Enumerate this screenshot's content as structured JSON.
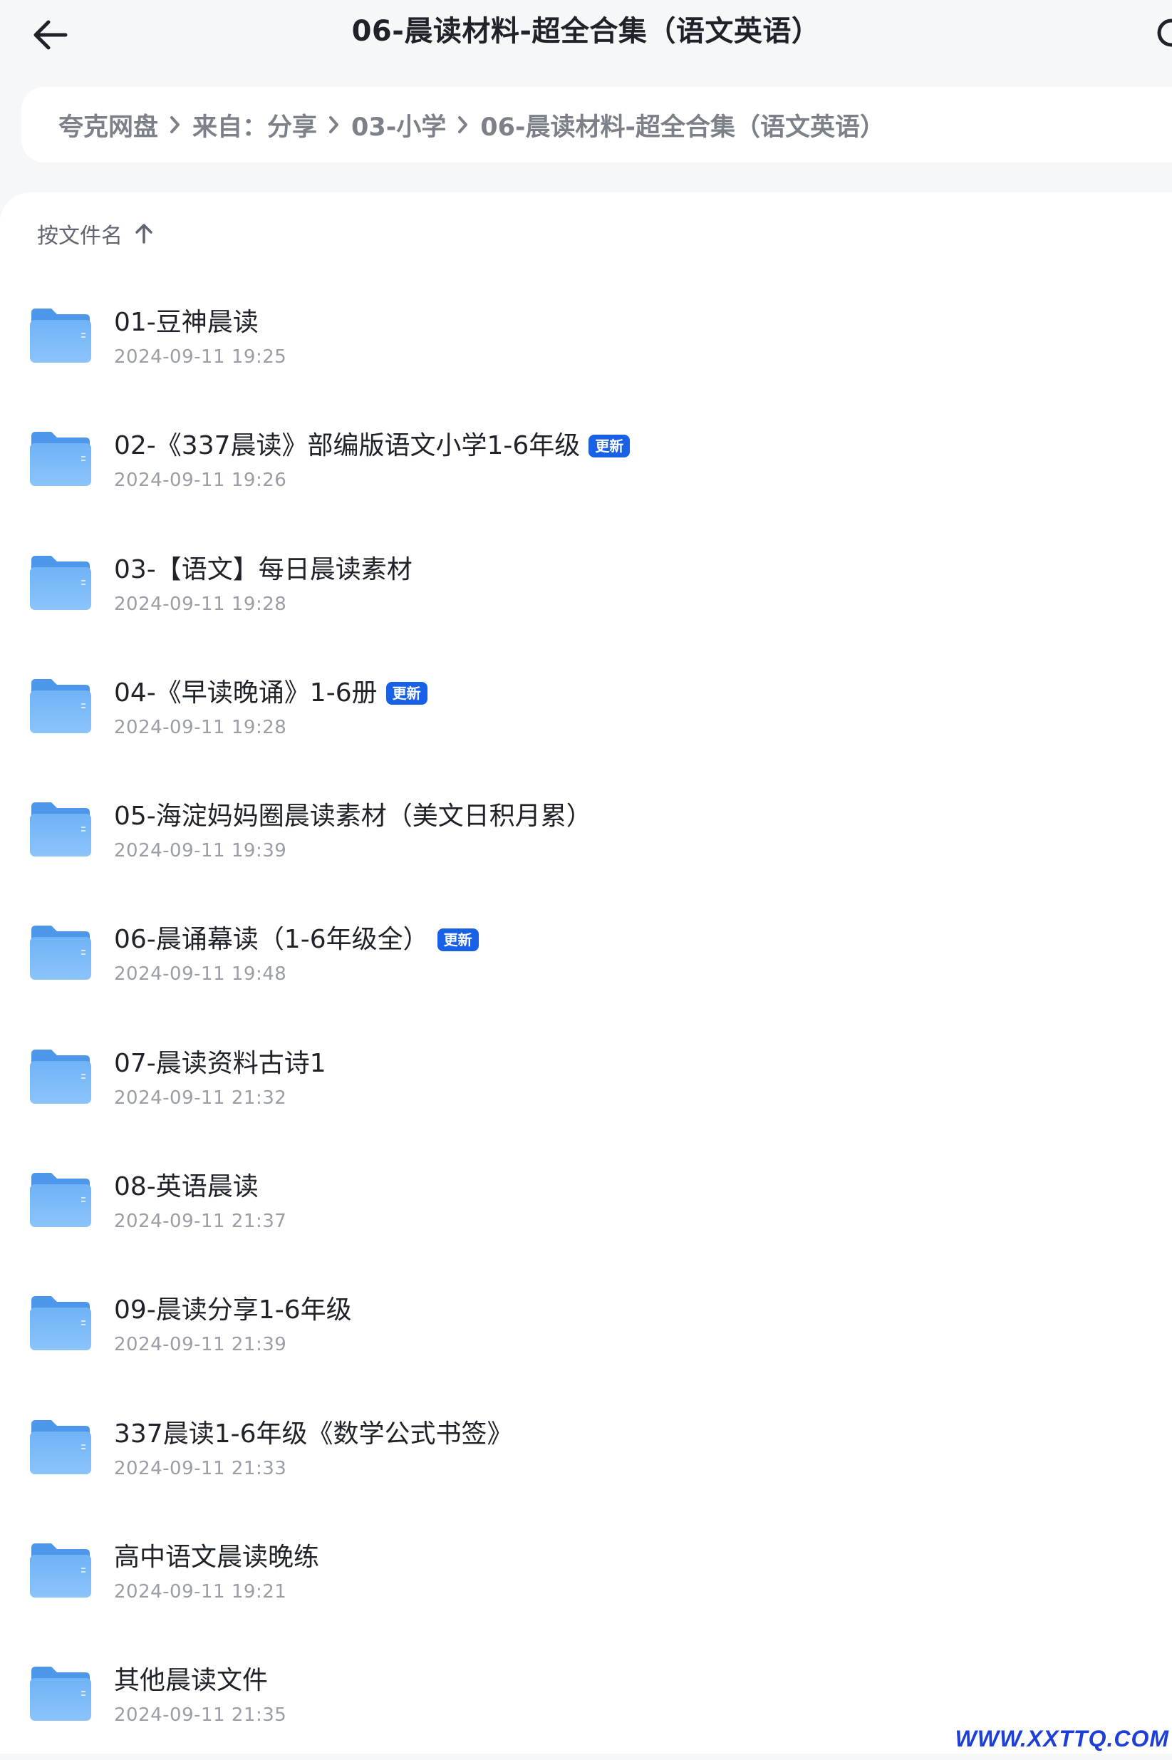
{
  "header": {
    "title": "06-晨读材料-超全合集（语文英语）",
    "back_icon": "arrow-left-icon",
    "search_icon": "search-icon"
  },
  "breadcrumb": [
    "夸克网盘",
    "来自：分享",
    "03-小学",
    "06-晨读材料-超全合集（语文英语）"
  ],
  "sort": {
    "label": "按文件名",
    "icon": "arrow-up-icon"
  },
  "files": [
    {
      "name": "01-豆神晨读",
      "date": "2024-09-11 19:25",
      "badge": ""
    },
    {
      "name": "02-《337晨读》部编版语文小学1-6年级",
      "date": "2024-09-11 19:26",
      "badge": "更新"
    },
    {
      "name": "03-【语文】每日晨读素材",
      "date": "2024-09-11 19:28",
      "badge": ""
    },
    {
      "name": "04-《早读晚诵》1-6册",
      "date": "2024-09-11 19:28",
      "badge": "更新"
    },
    {
      "name": "05-海淀妈妈圈晨读素材（美文日积月累）",
      "date": "2024-09-11 19:39",
      "badge": ""
    },
    {
      "name": "06-晨诵幕读（1-6年级全）",
      "date": "2024-09-11 19:48",
      "badge": "更新"
    },
    {
      "name": "07-晨读资料古诗1",
      "date": "2024-09-11 21:32",
      "badge": ""
    },
    {
      "name": "08-英语晨读",
      "date": "2024-09-11 21:37",
      "badge": ""
    },
    {
      "name": "09-晨读分享1-6年级",
      "date": "2024-09-11 21:39",
      "badge": ""
    },
    {
      "name": "337晨读1-6年级《数学公式书签》",
      "date": "2024-09-11 21:33",
      "badge": ""
    },
    {
      "name": "高中语文晨读晚练",
      "date": "2024-09-11 19:21",
      "badge": ""
    },
    {
      "name": "其他晨读文件",
      "date": "2024-09-11 21:35",
      "badge": ""
    }
  ],
  "watermark": "WWW.XXTTQ.COM",
  "colors": {
    "badge": "#1861e6",
    "folder": "#5aa2f0",
    "watermark": "#1d3fd8"
  }
}
